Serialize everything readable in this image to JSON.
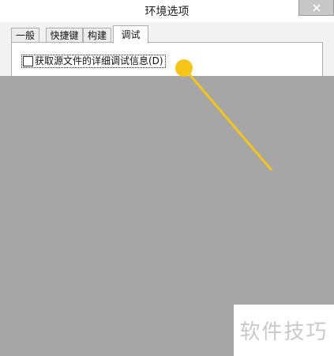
{
  "window": {
    "title": "环境选项",
    "close_icon": "close-icon"
  },
  "tabs": [
    {
      "label": "一般",
      "active": false
    },
    {
      "label": "快捷键",
      "active": false
    },
    {
      "label": "构建",
      "active": false
    },
    {
      "label": "调试",
      "active": true
    }
  ],
  "debug_panel": {
    "checkbox_label": "获取源文件的详细调试信息(D)",
    "checked": false
  },
  "watermark": {
    "text": "软件技巧"
  },
  "colors": {
    "annotation": "#f5c518",
    "overlay": "#a6a6a6"
  }
}
